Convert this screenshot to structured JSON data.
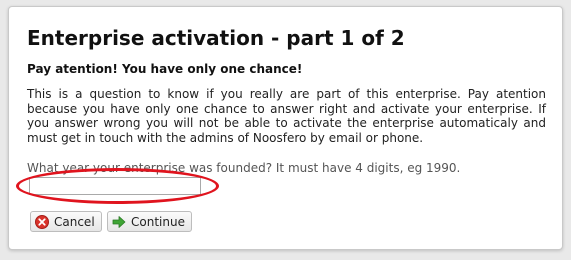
{
  "dialog": {
    "title": "Enterprise activation - part 1 of 2",
    "warning": "Pay atention! You have only one chance!",
    "body": "This is a question to know if you really are part of this enterprise. Pay atention because you have only one chance to answer right and activate your enterprise. If you answer wrong you will not be able to activate the enterprise automaticaly and must get in touch with the admins of Noosfero by email or phone.",
    "question": "What year your enterprise was founded? It must have 4 digits, eg 1990.",
    "answer_value": "",
    "buttons": {
      "cancel_label": "Cancel",
      "continue_label": "Continue"
    },
    "icons": {
      "cancel": "cancel-icon",
      "continue": "arrow-right-icon"
    },
    "colors": {
      "highlight": "#e0141e",
      "cancel_icon": "#d9332b",
      "continue_icon": "#3fa535"
    }
  }
}
